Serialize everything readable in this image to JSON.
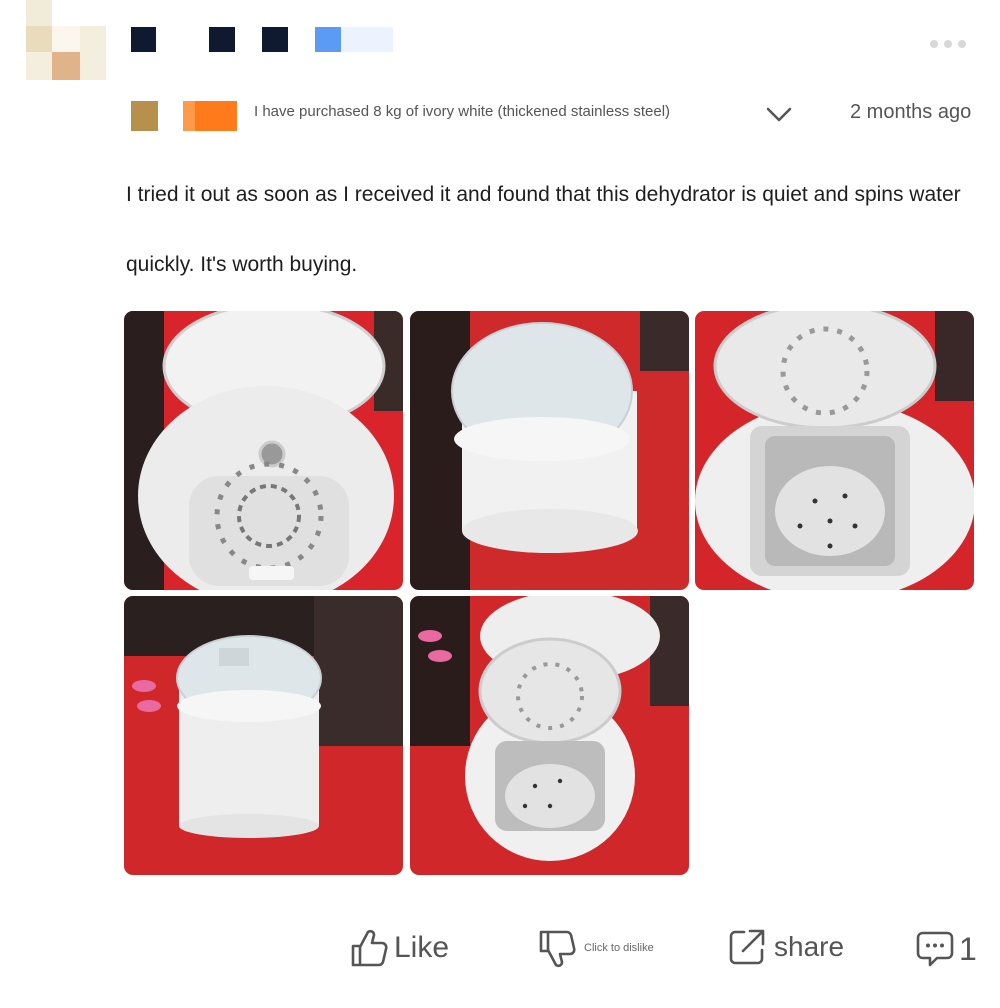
{
  "review": {
    "variant": "I have purchased 8 kg of ivory white (thickened stainless steel)",
    "time": "2 months ago",
    "text": "I tried it out as soon as I received it and found that this dehydrator is quiet and spins water quickly. It's worth buying."
  },
  "photos": [
    {
      "subject": "open-lid-top-view"
    },
    {
      "subject": "closed-dehydrator"
    },
    {
      "subject": "open-drum-interior"
    },
    {
      "subject": "closed-dehydrator-side"
    },
    {
      "subject": "open-drum-angled"
    }
  ],
  "actions": {
    "like_label": "Like",
    "dislike_label": "Click to dislike",
    "share_label": "share",
    "comment_count": "1"
  },
  "icons": {
    "more": "more-dots-icon",
    "expand": "chevron-down-icon",
    "like": "thumbs-up-icon",
    "dislike": "thumbs-down-icon",
    "share": "share-icon",
    "comment": "comment-icon"
  },
  "colors": {
    "text": "#1e1e1e",
    "muted": "#555555",
    "badge_orange": "#ff7a1a",
    "badge_gold": "#b8904e",
    "redacted_navy": "#0f1a30",
    "redacted_blue": "#5b9bf5"
  }
}
